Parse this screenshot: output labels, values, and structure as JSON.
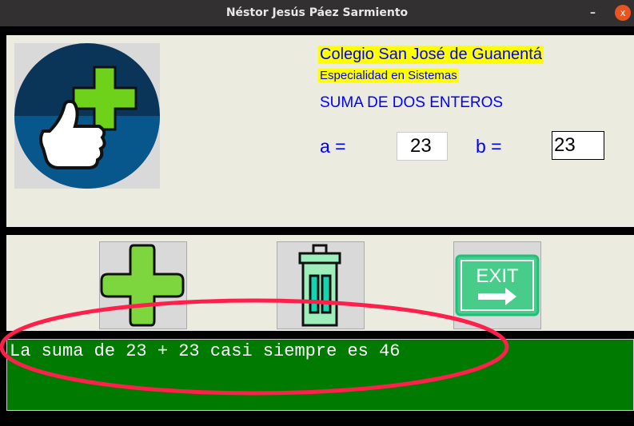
{
  "window": {
    "title": "Néstor Jesús Páez Sarmiento",
    "minimize": "–",
    "close": "x"
  },
  "header": {
    "school": "Colegio San José de Guanentá",
    "specialty": "Especialidad en Sistemas",
    "title": "SUMA DE DOS ENTEROS"
  },
  "form": {
    "a_label": "a =",
    "a_value": "23",
    "b_label": "b =",
    "b_value": "23"
  },
  "buttons": [
    {
      "icon": "plus-icon"
    },
    {
      "icon": "trash-icon"
    },
    {
      "icon": "exit-icon",
      "label": "EXIT"
    }
  ],
  "output": {
    "text": "La suma de 23 + 23 casi siempre es 46"
  },
  "colors": {
    "accent": "#0000ff",
    "output_bg": "#007a00",
    "highlight": "#ffff00",
    "annotation": "#ff1f4b"
  }
}
